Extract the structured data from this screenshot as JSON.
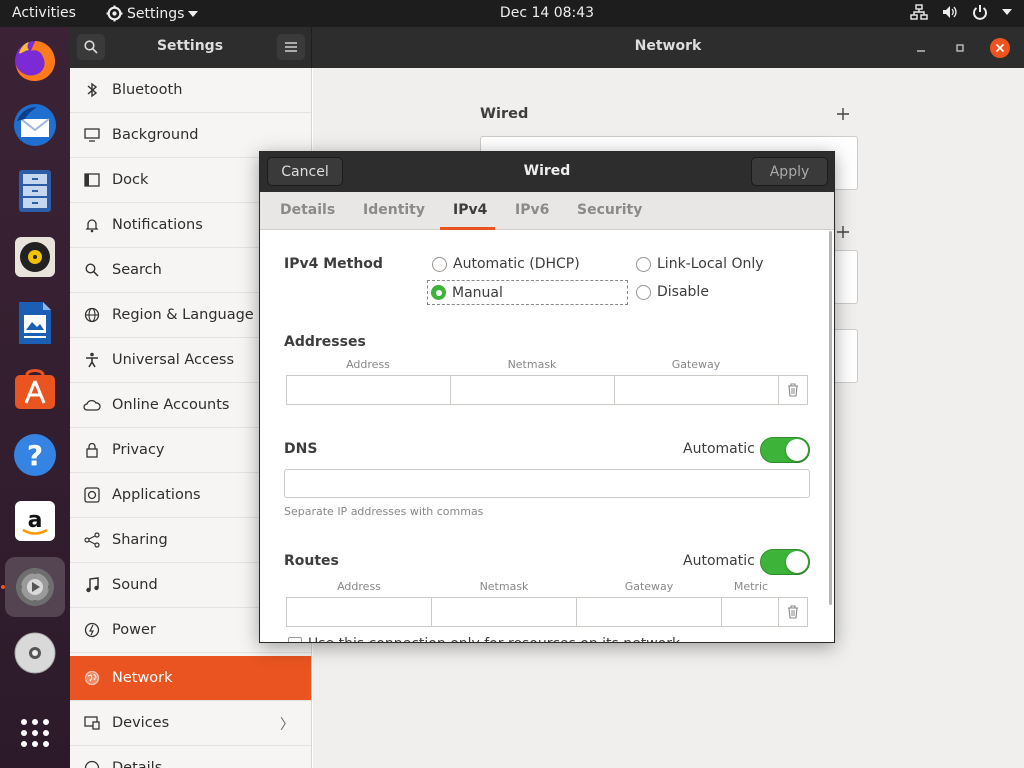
{
  "topbar": {
    "activities": "Activities",
    "app_menu": "Settings",
    "clock": "Dec 14  08:43"
  },
  "dock": {
    "items": [
      "firefox-icon",
      "thunderbird-icon",
      "files-icon",
      "rhythmbox-icon",
      "libreoffice-writer-icon",
      "ubuntu-software-icon",
      "help-icon",
      "amazon-icon",
      "settings-icon",
      "dvd-icon",
      "show-apps-icon"
    ]
  },
  "header": {
    "sidebar_title": "Settings",
    "panel_title": "Network"
  },
  "sidebar": {
    "items": [
      {
        "label": "Bluetooth",
        "icon": "bluetooth-icon"
      },
      {
        "label": "Background",
        "icon": "background-icon"
      },
      {
        "label": "Dock",
        "icon": "dock-icon"
      },
      {
        "label": "Notifications",
        "icon": "bell-icon"
      },
      {
        "label": "Search",
        "icon": "search-icon"
      },
      {
        "label": "Region & Language",
        "icon": "globe-icon"
      },
      {
        "label": "Universal Access",
        "icon": "accessibility-icon"
      },
      {
        "label": "Online Accounts",
        "icon": "cloud-icon"
      },
      {
        "label": "Privacy",
        "icon": "lock-icon"
      },
      {
        "label": "Applications",
        "icon": "applications-icon"
      },
      {
        "label": "Sharing",
        "icon": "share-icon"
      },
      {
        "label": "Sound",
        "icon": "music-icon"
      },
      {
        "label": "Power",
        "icon": "power-icon"
      },
      {
        "label": "Network",
        "icon": "network-icon"
      },
      {
        "label": "Devices",
        "icon": "devices-icon"
      },
      {
        "label": "Details",
        "icon": "details-icon"
      }
    ],
    "selected": "Network"
  },
  "main": {
    "wired_heading": "Wired"
  },
  "dialog": {
    "title": "Wired",
    "cancel_label": "Cancel",
    "apply_label": "Apply",
    "tabs": [
      "Details",
      "Identity",
      "IPv4",
      "IPv6",
      "Security"
    ],
    "active_tab": "IPv4",
    "ipv4_method_label": "IPv4 Method",
    "methods": {
      "auto_dhcp": "Automatic (DHCP)",
      "link_local": "Link-Local Only",
      "manual": "Manual",
      "disable": "Disable"
    },
    "selected_method": "Manual",
    "addresses": {
      "heading": "Addresses",
      "col_address": "Address",
      "col_netmask": "Netmask",
      "col_gateway": "Gateway"
    },
    "dns": {
      "heading": "DNS",
      "automatic_label": "Automatic",
      "automatic_on": true,
      "hint": "Separate IP addresses with commas"
    },
    "routes": {
      "heading": "Routes",
      "automatic_label": "Automatic",
      "automatic_on": true,
      "col_address": "Address",
      "col_netmask": "Netmask",
      "col_gateway": "Gateway",
      "col_metric": "Metric"
    },
    "cutoff_checkbox_label": "Use this connection only for resources on its network"
  },
  "colors": {
    "accent": "#e95420",
    "toggle_on": "#3db33a",
    "header_bg": "#2d2d2d"
  }
}
